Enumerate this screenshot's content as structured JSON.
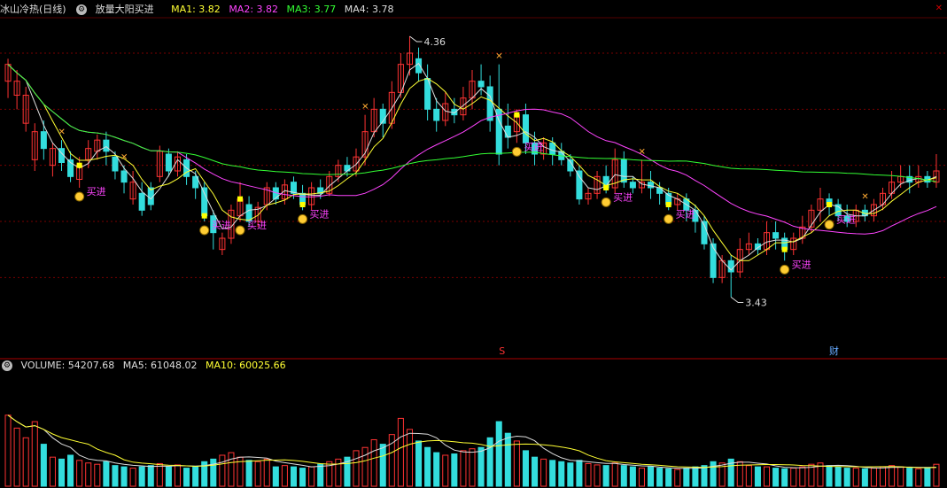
{
  "header": {
    "title": "冰山冷热(日线)",
    "formula": "放量大阳买进",
    "ma": [
      {
        "label": "MA1: 3.82",
        "color": "#ffff33"
      },
      {
        "label": "MA2: 3.82",
        "color": "#ff44ff"
      },
      {
        "label": "MA3: 3.77",
        "color": "#33ff33"
      },
      {
        "label": "MA4: 3.78",
        "color": "#dddddd"
      }
    ]
  },
  "volume_header": {
    "label": "VOLUME: 54207.68",
    "ma5": "MA5: 61048.02",
    "ma10": "MA10: 60025.66"
  },
  "annotations": {
    "high_label": "4.36",
    "low_label": "3.43",
    "buy_label": "买进",
    "marker_s": "S",
    "marker_cai": "财"
  },
  "colors": {
    "up": "#ff3333",
    "down": "#33dddd",
    "ma1": "#ffff33",
    "ma2": "#ff44ff",
    "ma3": "#33ff33",
    "ma4": "#dddddd",
    "buy": "#ff44ff",
    "grid": "#7a0000",
    "signal": "#ffff00"
  },
  "chart_data": {
    "type": "candlestick",
    "price_range": [
      3.4,
      4.42
    ],
    "high": 4.36,
    "low": 3.43,
    "candles": [
      [
        4.2,
        4.26,
        4.14,
        4.28
      ],
      [
        4.15,
        4.2,
        4.1,
        4.24
      ],
      [
        4.05,
        4.15,
        4.02,
        4.18
      ],
      [
        3.92,
        4.02,
        3.88,
        4.05
      ],
      [
        4.02,
        3.96,
        3.92,
        4.06
      ],
      [
        3.9,
        3.96,
        3.86,
        3.98
      ],
      [
        3.96,
        3.91,
        3.88,
        3.99
      ],
      [
        3.92,
        3.86,
        3.84,
        3.95
      ],
      [
        3.85,
        3.9,
        3.82,
        3.93
      ],
      [
        3.92,
        3.96,
        3.89,
        3.99
      ],
      [
        3.95,
        3.99,
        3.92,
        4.01
      ],
      [
        3.99,
        3.95,
        3.9,
        4.02
      ],
      [
        3.93,
        3.88,
        3.85,
        3.95
      ],
      [
        3.88,
        3.84,
        3.8,
        3.9
      ],
      [
        3.78,
        3.84,
        3.76,
        3.88
      ],
      [
        3.8,
        3.74,
        3.72,
        3.84
      ],
      [
        3.82,
        3.76,
        3.74,
        3.84
      ],
      [
        3.86,
        3.95,
        3.84,
        3.97
      ],
      [
        3.94,
        3.88,
        3.86,
        3.96
      ],
      [
        3.88,
        3.93,
        3.86,
        3.95
      ],
      [
        3.92,
        3.86,
        3.83,
        3.94
      ],
      [
        3.86,
        3.82,
        3.78,
        3.88
      ],
      [
        3.82,
        3.72,
        3.7,
        3.84
      ],
      [
        3.72,
        3.66,
        3.6,
        3.74
      ],
      [
        3.6,
        3.64,
        3.58,
        3.66
      ],
      [
        3.64,
        3.74,
        3.62,
        3.76
      ],
      [
        3.72,
        3.78,
        3.7,
        3.84
      ],
      [
        3.76,
        3.7,
        3.68,
        3.79
      ],
      [
        3.7,
        3.75,
        3.68,
        3.77
      ],
      [
        3.76,
        3.82,
        3.74,
        3.84
      ],
      [
        3.82,
        3.78,
        3.76,
        3.84
      ],
      [
        3.78,
        3.83,
        3.76,
        3.85
      ],
      [
        3.84,
        3.8,
        3.78,
        3.86
      ],
      [
        3.8,
        3.76,
        3.74,
        3.83
      ],
      [
        3.76,
        3.82,
        3.74,
        3.84
      ],
      [
        3.82,
        3.8,
        3.78,
        3.85
      ],
      [
        3.8,
        3.86,
        3.79,
        3.88
      ],
      [
        3.86,
        3.9,
        3.84,
        3.92
      ],
      [
        3.9,
        3.88,
        3.86,
        3.93
      ],
      [
        3.88,
        3.93,
        3.86,
        3.96
      ],
      [
        3.93,
        4.02,
        3.9,
        4.08
      ],
      [
        4.02,
        4.1,
        4.0,
        4.14
      ],
      [
        4.1,
        4.05,
        4.0,
        4.12
      ],
      [
        4.05,
        4.16,
        4.03,
        4.2
      ],
      [
        4.16,
        4.26,
        4.14,
        4.3
      ],
      [
        4.26,
        4.3,
        4.22,
        4.36
      ],
      [
        4.28,
        4.23,
        4.2,
        4.32
      ],
      [
        4.21,
        4.1,
        4.06,
        4.26
      ],
      [
        4.1,
        4.06,
        4.02,
        4.14
      ],
      [
        4.06,
        4.12,
        4.04,
        4.16
      ],
      [
        4.1,
        4.08,
        4.05,
        4.14
      ],
      [
        4.08,
        4.14,
        4.06,
        4.18
      ],
      [
        4.14,
        4.2,
        4.1,
        4.24
      ],
      [
        4.2,
        4.18,
        4.15,
        4.26
      ],
      [
        4.18,
        4.06,
        4.02,
        4.22
      ],
      [
        4.1,
        3.94,
        3.9,
        4.26
      ],
      [
        4.04,
        4.0,
        3.96,
        4.12
      ],
      [
        4.02,
        4.08,
        3.98,
        4.1
      ],
      [
        4.08,
        3.98,
        3.94,
        4.12
      ],
      [
        3.98,
        3.94,
        3.9,
        4.02
      ],
      [
        3.94,
        3.98,
        3.92,
        4.0
      ],
      [
        3.98,
        3.94,
        3.9,
        4.0
      ],
      [
        3.95,
        3.92,
        3.9,
        3.98
      ],
      [
        3.92,
        3.88,
        3.86,
        3.94
      ],
      [
        3.88,
        3.78,
        3.76,
        3.9
      ],
      [
        3.78,
        3.8,
        3.76,
        3.82
      ],
      [
        3.8,
        3.86,
        3.78,
        3.88
      ],
      [
        3.86,
        3.82,
        3.8,
        3.9
      ],
      [
        3.82,
        3.92,
        3.8,
        3.96
      ],
      [
        3.92,
        3.84,
        3.82,
        3.95
      ],
      [
        3.84,
        3.82,
        3.8,
        3.86
      ],
      [
        3.82,
        3.84,
        3.8,
        3.92
      ],
      [
        3.84,
        3.82,
        3.78,
        3.88
      ],
      [
        3.82,
        3.8,
        3.76,
        3.84
      ],
      [
        3.8,
        3.76,
        3.74,
        3.82
      ],
      [
        3.76,
        3.78,
        3.74,
        3.8
      ],
      [
        3.78,
        3.74,
        3.7,
        3.8
      ],
      [
        3.74,
        3.7,
        3.66,
        3.76
      ],
      [
        3.7,
        3.62,
        3.6,
        3.72
      ],
      [
        3.62,
        3.5,
        3.48,
        3.64
      ],
      [
        3.5,
        3.56,
        3.48,
        3.58
      ],
      [
        3.56,
        3.52,
        3.43,
        3.58
      ],
      [
        3.52,
        3.6,
        3.5,
        3.64
      ],
      [
        3.6,
        3.62,
        3.58,
        3.66
      ],
      [
        3.62,
        3.6,
        3.58,
        3.64
      ],
      [
        3.6,
        3.66,
        3.58,
        3.7
      ],
      [
        3.66,
        3.64,
        3.6,
        3.7
      ],
      [
        3.64,
        3.6,
        3.56,
        3.66
      ],
      [
        3.6,
        3.64,
        3.58,
        3.66
      ],
      [
        3.64,
        3.68,
        3.62,
        3.72
      ],
      [
        3.68,
        3.74,
        3.66,
        3.76
      ],
      [
        3.74,
        3.78,
        3.7,
        3.82
      ],
      [
        3.78,
        3.76,
        3.72,
        3.8
      ],
      [
        3.76,
        3.72,
        3.7,
        3.78
      ],
      [
        3.72,
        3.7,
        3.68,
        3.76
      ],
      [
        3.7,
        3.74,
        3.68,
        3.76
      ],
      [
        3.74,
        3.72,
        3.7,
        3.76
      ],
      [
        3.72,
        3.76,
        3.7,
        3.78
      ],
      [
        3.76,
        3.8,
        3.74,
        3.82
      ],
      [
        3.8,
        3.84,
        3.78,
        3.88
      ],
      [
        3.84,
        3.86,
        3.82,
        3.9
      ],
      [
        3.86,
        3.84,
        3.8,
        3.9
      ],
      [
        3.84,
        3.86,
        3.82,
        3.9
      ],
      [
        3.86,
        3.84,
        3.82,
        3.88
      ],
      [
        3.84,
        3.88,
        3.82,
        3.94
      ]
    ],
    "volume_scale_max": 170000,
    "volume": [
      110000,
      90000,
      75000,
      100000,
      65000,
      45000,
      42000,
      48000,
      40000,
      36000,
      34000,
      38000,
      32000,
      30000,
      28000,
      30000,
      32000,
      35000,
      30000,
      33000,
      28000,
      30000,
      38000,
      42000,
      48000,
      52000,
      45000,
      40000,
      38000,
      42000,
      30000,
      32000,
      30000,
      28000,
      30000,
      34000,
      38000,
      42000,
      45000,
      55000,
      60000,
      72000,
      65000,
      80000,
      105000,
      88000,
      70000,
      60000,
      52000,
      48000,
      50000,
      55000,
      58000,
      60000,
      75000,
      100000,
      82000,
      70000,
      55000,
      45000,
      42000,
      40000,
      38000,
      36000,
      40000,
      35000,
      33000,
      32000,
      36000,
      32000,
      30000,
      28000,
      30000,
      28000,
      27000,
      26000,
      28000,
      30000,
      32000,
      38000,
      36000,
      42000,
      38000,
      32000,
      30000,
      30000,
      28000,
      27000,
      28000,
      30000,
      34000,
      36000,
      32000,
      30000,
      28000,
      28000,
      27000,
      28000,
      30000,
      32000,
      30000,
      28000,
      27000,
      28000,
      34000
    ],
    "volume_ma5_final": 61048.02,
    "volume_ma10_final": 60025.66,
    "buy_signals": [
      8,
      22,
      26,
      33,
      57,
      67,
      74,
      87,
      92,
      105
    ],
    "top_signals": [
      6,
      13,
      40,
      55,
      71,
      96,
      112
    ]
  }
}
